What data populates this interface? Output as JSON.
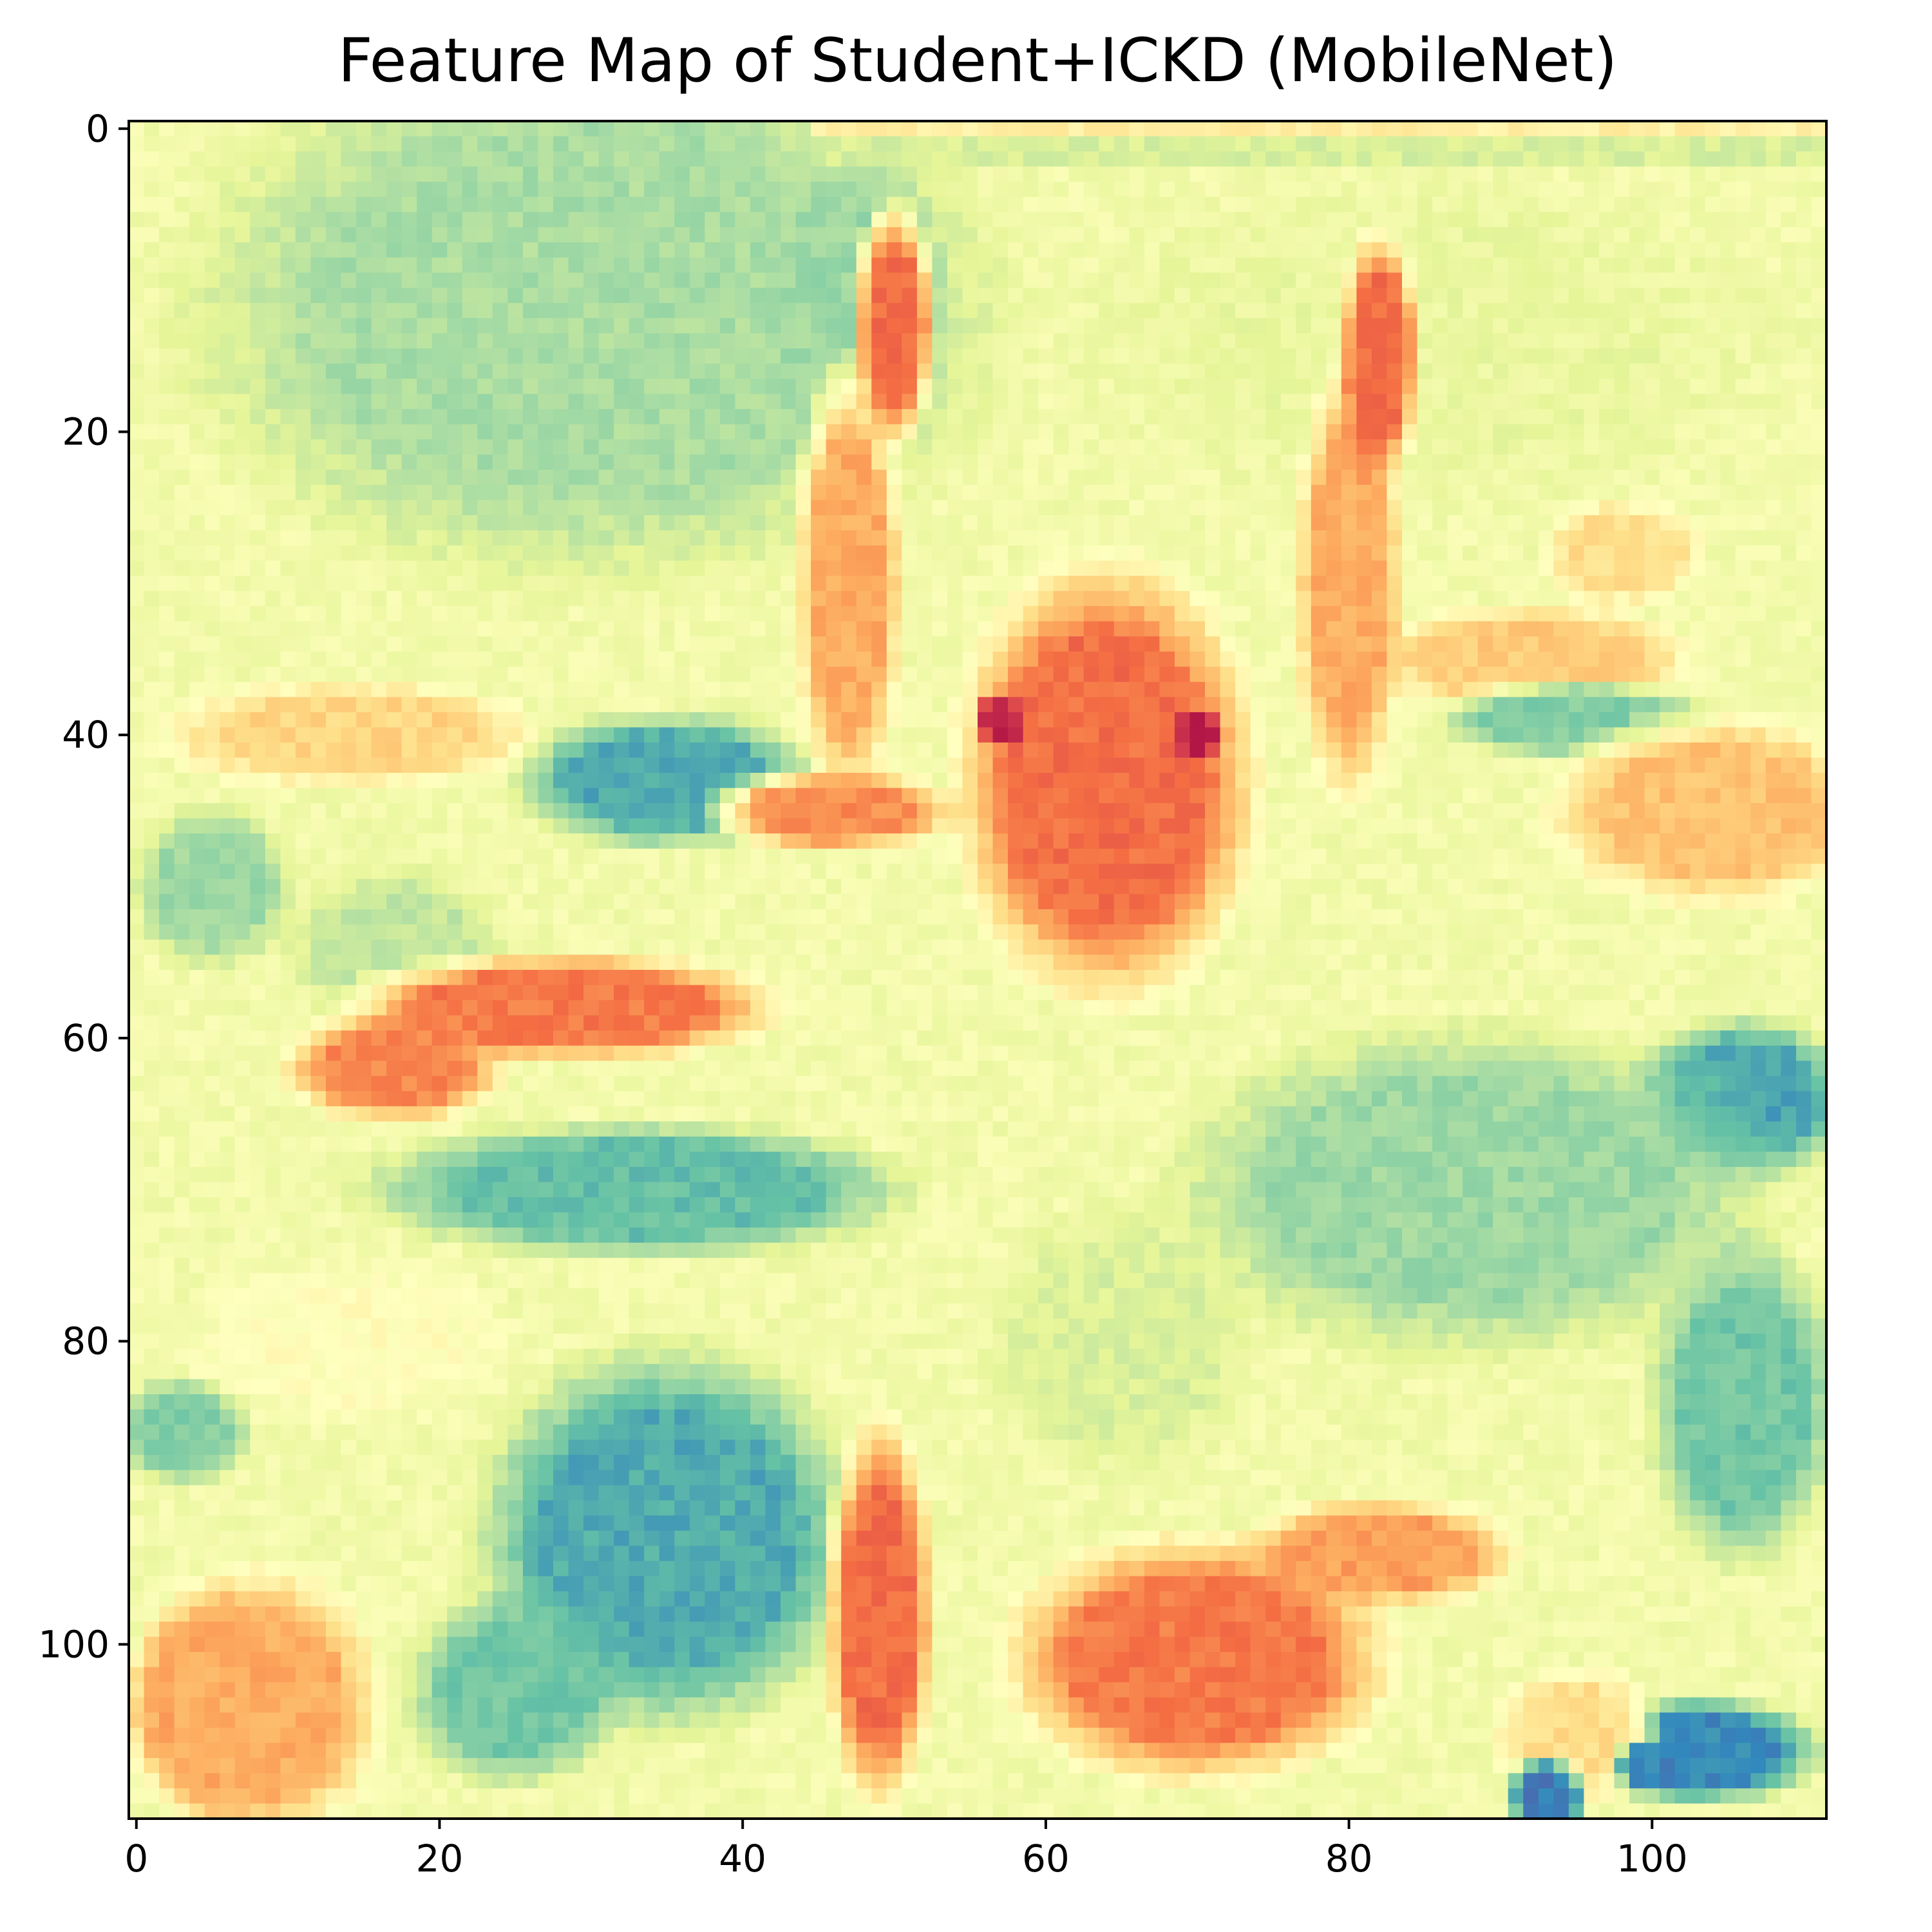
{
  "chart_data": {
    "type": "heatmap",
    "title": "Feature Map of Student+ICKD (MobileNet)",
    "colormap": "Spectral",
    "colormap_stops": [
      "#9e0142",
      "#d53e4f",
      "#f46d43",
      "#fdae61",
      "#fee08b",
      "#ffffbf",
      "#e6f598",
      "#abdda4",
      "#66c2a5",
      "#3288bd",
      "#5e4fa2"
    ],
    "grid_size": [
      112,
      112
    ],
    "grid": false,
    "xlim": [
      -0.5,
      111.5
    ],
    "ylim": [
      111.5,
      -0.5
    ],
    "x_ticks": [
      0,
      20,
      40,
      60,
      80,
      100
    ],
    "y_ticks": [
      0,
      20,
      40,
      60,
      80,
      100
    ],
    "x_tick_labels": [
      "0",
      "20",
      "40",
      "60",
      "80",
      "100"
    ],
    "y_tick_labels": [
      "0",
      "20",
      "40",
      "60",
      "80",
      "100"
    ],
    "value_range": [
      0,
      1
    ],
    "base_value": 0.55,
    "regions": [
      {
        "kind": "ellipse",
        "cx": 30,
        "cy": 12,
        "rx": 30,
        "ry": 20,
        "value": 0.7
      },
      {
        "kind": "ellipse",
        "cx": 48,
        "cy": 12,
        "rx": 6,
        "ry": 12,
        "value": 0.72
      },
      {
        "kind": "ellipse",
        "cx": 85,
        "cy": 14,
        "rx": 26,
        "ry": 12,
        "value": 0.58
      },
      {
        "kind": "ellipse",
        "cx": 14,
        "cy": 40,
        "rx": 14,
        "ry": 4,
        "value": 0.38
      },
      {
        "kind": "ellipse",
        "cx": 35,
        "cy": 43,
        "rx": 11,
        "ry": 5,
        "value": 0.84
      },
      {
        "kind": "ellipse",
        "cx": 5,
        "cy": 50,
        "rx": 6,
        "ry": 6,
        "value": 0.72
      },
      {
        "kind": "ellipse",
        "cx": 17,
        "cy": 54,
        "rx": 8,
        "ry": 6,
        "value": 0.66
      },
      {
        "kind": "ellipse",
        "cx": 92,
        "cy": 35,
        "rx": 12,
        "ry": 4,
        "value": 0.36
      },
      {
        "kind": "ellipse",
        "cx": 95,
        "cy": 39,
        "rx": 10,
        "ry": 3,
        "value": 0.76
      },
      {
        "kind": "ellipse",
        "cx": 104,
        "cy": 45,
        "rx": 12,
        "ry": 7,
        "value": 0.34
      },
      {
        "kind": "ellipse",
        "cx": 106,
        "cy": 64,
        "rx": 8,
        "ry": 6,
        "value": 0.85
      },
      {
        "kind": "ellipse",
        "cx": 106,
        "cy": 84,
        "rx": 7,
        "ry": 12,
        "value": 0.78
      },
      {
        "kind": "ellipse",
        "cx": 103,
        "cy": 107,
        "rx": 9,
        "ry": 4,
        "value": 0.9
      },
      {
        "kind": "ellipse",
        "cx": 88,
        "cy": 70,
        "rx": 22,
        "ry": 12,
        "value": 0.72
      },
      {
        "kind": "ellipse",
        "cx": 65,
        "cy": 80,
        "rx": 10,
        "ry": 10,
        "value": 0.62
      },
      {
        "kind": "ellipse",
        "cx": 33,
        "cy": 70,
        "rx": 20,
        "ry": 5,
        "value": 0.8
      },
      {
        "kind": "ellipse",
        "cx": 14,
        "cy": 80,
        "rx": 12,
        "ry": 6,
        "value": 0.5
      },
      {
        "kind": "ellipse",
        "cx": 3,
        "cy": 86,
        "rx": 5,
        "ry": 4,
        "value": 0.76
      },
      {
        "kind": "ellipse",
        "cx": 35,
        "cy": 93,
        "rx": 14,
        "ry": 14,
        "value": 0.84
      },
      {
        "kind": "ellipse",
        "cx": 25,
        "cy": 103,
        "rx": 8,
        "ry": 7,
        "value": 0.78
      },
      {
        "kind": "ellipse",
        "cx": 5,
        "cy": 104,
        "rx": 6,
        "ry": 8,
        "value": 0.25
      },
      {
        "kind": "ellipse",
        "cx": 47,
        "cy": 30,
        "rx": 4,
        "ry": 16,
        "value": 0.3
      },
      {
        "kind": "ellipse",
        "cx": 80,
        "cy": 30,
        "rx": 4,
        "ry": 16,
        "value": 0.3
      },
      {
        "kind": "ellipse",
        "cx": 50,
        "cy": 13,
        "rx": 3,
        "ry": 9,
        "value": 0.2
      },
      {
        "kind": "ellipse",
        "cx": 82,
        "cy": 15,
        "rx": 3,
        "ry": 9,
        "value": 0.2
      },
      {
        "kind": "ellipse",
        "cx": 64,
        "cy": 43,
        "rx": 11,
        "ry": 16,
        "value": 0.2
      },
      {
        "kind": "ellipse",
        "cx": 57,
        "cy": 39,
        "rx": 2,
        "ry": 2,
        "value": 0.05
      },
      {
        "kind": "ellipse",
        "cx": 70,
        "cy": 40,
        "rx": 2,
        "ry": 2,
        "value": 0.05
      },
      {
        "kind": "ellipse",
        "cx": 46,
        "cy": 45,
        "rx": 9,
        "ry": 3,
        "value": 0.25
      },
      {
        "kind": "ellipse",
        "cx": 28,
        "cy": 58,
        "rx": 16,
        "ry": 4,
        "value": 0.22
      },
      {
        "kind": "ellipse",
        "cx": 17,
        "cy": 62,
        "rx": 8,
        "ry": 4,
        "value": 0.24
      },
      {
        "kind": "ellipse",
        "cx": 49,
        "cy": 98,
        "rx": 4,
        "ry": 14,
        "value": 0.2
      },
      {
        "kind": "ellipse",
        "cx": 70,
        "cy": 101,
        "rx": 14,
        "ry": 9,
        "value": 0.22
      },
      {
        "kind": "ellipse",
        "cx": 82,
        "cy": 94,
        "rx": 10,
        "ry": 4,
        "value": 0.28
      },
      {
        "kind": "ellipse",
        "cx": 8,
        "cy": 104,
        "rx": 9,
        "ry": 10,
        "value": 0.3
      },
      {
        "kind": "ellipse",
        "cx": 95,
        "cy": 106,
        "rx": 6,
        "ry": 5,
        "value": 0.4
      },
      {
        "kind": "ellipse",
        "cx": 98,
        "cy": 28,
        "rx": 6,
        "ry": 4,
        "value": 0.4
      },
      {
        "kind": "ellipse",
        "cx": 93,
        "cy": 110,
        "rx": 3,
        "ry": 3,
        "value": 0.92
      },
      {
        "kind": "ellipse",
        "cx": 100,
        "cy": 108,
        "rx": 3,
        "ry": 2,
        "value": 0.9
      },
      {
        "kind": "hband",
        "y0": 0,
        "y1": 1,
        "x0": 45,
        "x1": 111,
        "value": 0.45
      },
      {
        "kind": "hband",
        "y0": 1,
        "y1": 2,
        "x0": 45,
        "x1": 111,
        "value": 0.62
      }
    ]
  }
}
